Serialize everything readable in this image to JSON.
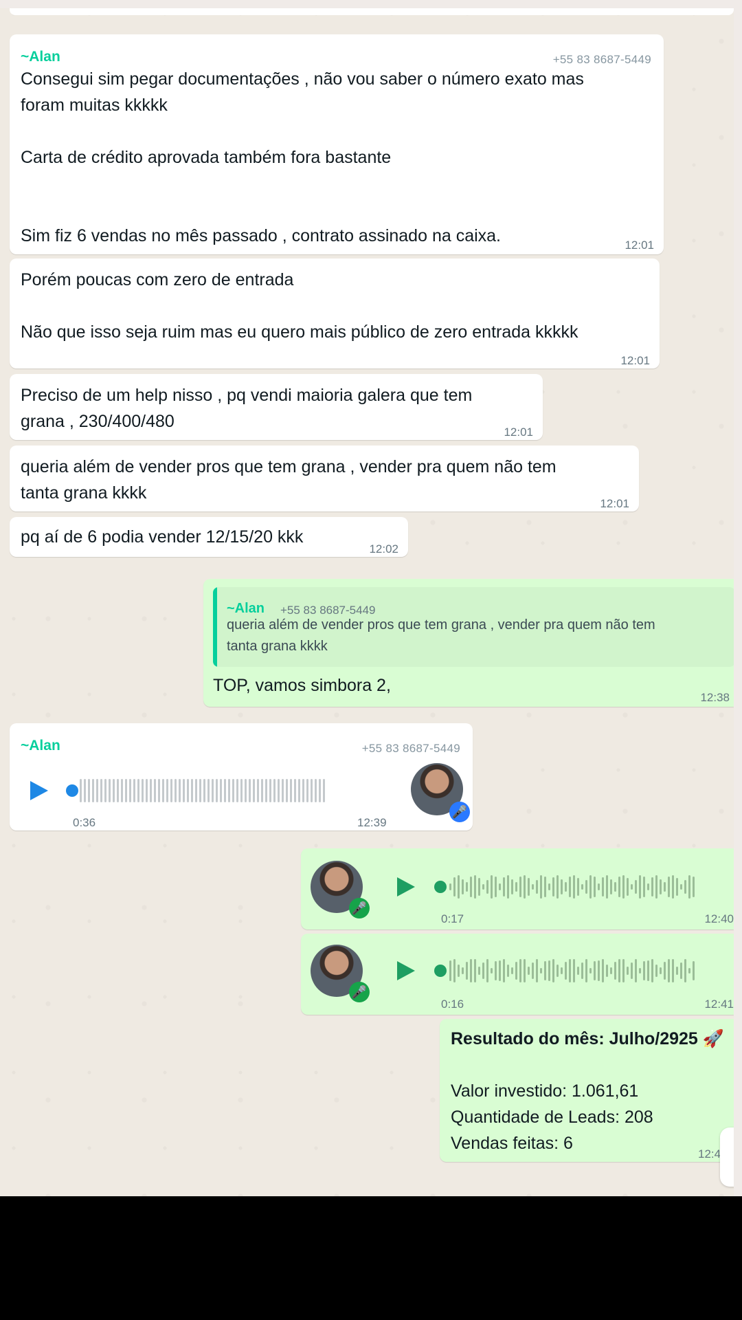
{
  "messages": {
    "m1": {
      "sender": "~Alan",
      "phone": "+55 83 8687-5449",
      "text": "Consegui sim pegar documentações , não vou saber o número exato mas\nforam muitas kkkkk\n\nCarta de crédito aprovada também fora bastante\n\n\nSim fiz 6 vendas no mês passado , contrato assinado na caixa.",
      "time": "12:01"
    },
    "m2": {
      "text": "Porém poucas com zero de entrada\n\nNão que isso seja ruim mas eu quero mais público de zero entrada kkkkk",
      "time": "12:01"
    },
    "m3": {
      "text": "Preciso de um help nisso , pq vendi maioria galera que tem\ngrana , 230/400/480",
      "time": "12:01"
    },
    "m4": {
      "text": "queria além de vender pros que tem grana , vender pra quem não tem\ntanta grana kkkk",
      "time": "12:01"
    },
    "m5": {
      "text": "pq aí de 6 podia vender 12/15/20 kkk",
      "time": "12:02"
    },
    "m6": {
      "quote_sender": "~Alan",
      "quote_phone": "+55 83 8687-5449",
      "quote_text": "queria além de vender pros que tem grana , vender pra quem não tem\ntanta grana kkkk",
      "text": "TOP, vamos simbora 2,",
      "time": "12:38"
    },
    "m7": {
      "sender": "~Alan",
      "phone": "+55 83 8687-5449",
      "duration": "0:36",
      "time": "12:39",
      "avatar_icon": "avatar",
      "mic_icon": "microphone-icon"
    },
    "m8": {
      "duration": "0:17",
      "time": "12:40",
      "mic_icon": "microphone-icon"
    },
    "m9": {
      "duration": "0:16",
      "time": "12:41",
      "mic_icon": "microphone-icon"
    },
    "m10": {
      "title": "Resultado do mês: Julho/2925 🚀",
      "line1": "Valor investido: 1.061,61",
      "line2": "Quantidade de Leads: 208",
      "line3": "Vendas feitas: 6",
      "time": "12:4"
    }
  },
  "icons": {
    "play": "play-icon",
    "mic": "🎤",
    "scroll": "scroll-down-button"
  },
  "colors": {
    "sender": "#06cf9c",
    "incoming": "#ffffff",
    "outgoing": "#d9fdd3",
    "play_in": "#1e88e5",
    "play_out": "#1e9e62",
    "mic_badge_in": "#2979ff",
    "mic_badge_out": "#16a34a"
  }
}
